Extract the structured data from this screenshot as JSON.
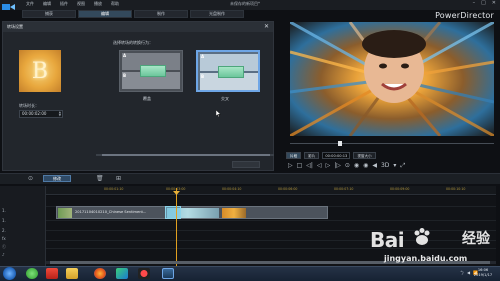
{
  "app": {
    "menu": [
      "文件",
      "编辑",
      "插件",
      "视图",
      "播放",
      "帮助"
    ],
    "document_title": "未保存的新项目*",
    "brand": "PowerDirector",
    "window_controls": [
      "–",
      "□",
      "✕"
    ]
  },
  "mode_tabs": [
    "捕获",
    "编辑",
    "制作",
    "光盘制作"
  ],
  "transition_panel": {
    "title": "转场设置",
    "close": "✕",
    "preview_letter": "B",
    "duration_label": "转场时长：",
    "duration_value": "00:00:02:00",
    "behavior_label": "选择转场的转换行为：",
    "options": [
      {
        "label_a": "A",
        "label_b": "B",
        "caption": "覆盖"
      },
      {
        "label_a": "A",
        "label_b": "B",
        "caption": "交叉"
      }
    ]
  },
  "preview": {
    "buttons": [
      "片段",
      "影片"
    ],
    "timecode": "00:00:00:13",
    "fit_label": "视窗大小",
    "transport": [
      "▷",
      "□",
      "◁|",
      "◁",
      "▷",
      "|▷",
      "⊙",
      "◉",
      "◉",
      "◀",
      "3D",
      "▾",
      "⤢"
    ]
  },
  "timeline_toolbar": {
    "edit_button": "修改",
    "icons": [
      "⊙",
      "🗑",
      "⊞"
    ]
  },
  "timeline": {
    "ruler_ticks": [
      "00:00:00:00",
      "00:00:01:10",
      "00:00:03:00",
      "00:00:04:10",
      "00:00:06:00",
      "00:00:07:10",
      "00:00:09:00",
      "00:00:10:10",
      "00:00:12:00",
      "00:00:13:10"
    ],
    "tracks": [
      "1.",
      "1.",
      "2.",
      "fx",
      "ⓣ",
      "♪"
    ],
    "clip_name": "20171104010210_Chinese Sentiment..."
  },
  "taskbar": {
    "tray": [
      "ㄅ",
      "◀",
      "📶"
    ],
    "time": "16:06",
    "date": "2019/1/17"
  },
  "watermark": {
    "brand": "Bai",
    "cn": "经验",
    "url": "jingyan.baidu.com"
  },
  "colors": {
    "accent": "#6ea6e6",
    "playhead": "#e0a020",
    "transition_green": "#6cc69c",
    "mode_tab_active": "#33495c"
  }
}
